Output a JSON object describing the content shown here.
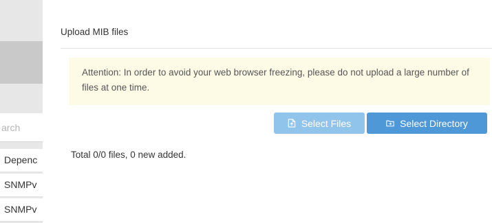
{
  "background": {
    "search_placeholder": "arch",
    "rows": [
      "Depenc",
      "SNMPv",
      "SNMPv"
    ]
  },
  "modal": {
    "title": "Upload MIB files",
    "attention_text": "Attention: In order to avoid your web browser freezing, please do not upload a large number of files at one time.",
    "select_files_label": "Select Files",
    "select_directory_label": "Select Directory",
    "total_text": "Total 0/0 files, 0 new added."
  },
  "icons": {
    "select_files": "file-icon",
    "select_directory": "folder-icon"
  },
  "colors": {
    "attention_bg": "#fdfbe6",
    "select_files_bg": "#90c4ea",
    "select_directory_bg": "#4f98d8"
  }
}
